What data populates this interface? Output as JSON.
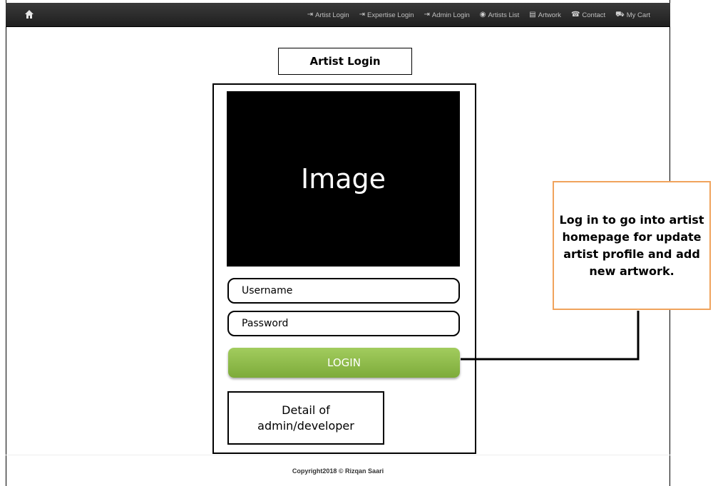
{
  "navbar": {
    "home_icon": "home-icon",
    "items": [
      {
        "label": "Artist Login",
        "icon": "login-icon",
        "glyph": "⇥"
      },
      {
        "label": "Expertise Login",
        "icon": "login-icon",
        "glyph": "⇥"
      },
      {
        "label": "Admin Login",
        "icon": "login-icon",
        "glyph": "⇥"
      },
      {
        "label": "Artists List",
        "icon": "globe-icon",
        "glyph": "◉"
      },
      {
        "label": "Artwork",
        "icon": "list-icon",
        "glyph": "▤"
      },
      {
        "label": "Contact",
        "icon": "phone-icon",
        "glyph": "☎"
      },
      {
        "label": "My Cart",
        "icon": "cart-icon",
        "glyph": "⛟"
      }
    ]
  },
  "page": {
    "title": "Artist Login",
    "image_label": "Image",
    "username_placeholder": "Username",
    "password_placeholder": "Password",
    "login_label": "LOGIN",
    "detail_line1": "Detail of",
    "detail_line2": "admin/developer"
  },
  "callout": {
    "text": "Log in to go into artist homepage for update artist profile and add new artwork."
  },
  "footer": {
    "copyright": "Copyright2018 © Rizqan Saari"
  },
  "colors": {
    "navbar": "#2a2a2a",
    "login_button": "#8ab948",
    "callout_border": "#f0a35c"
  }
}
